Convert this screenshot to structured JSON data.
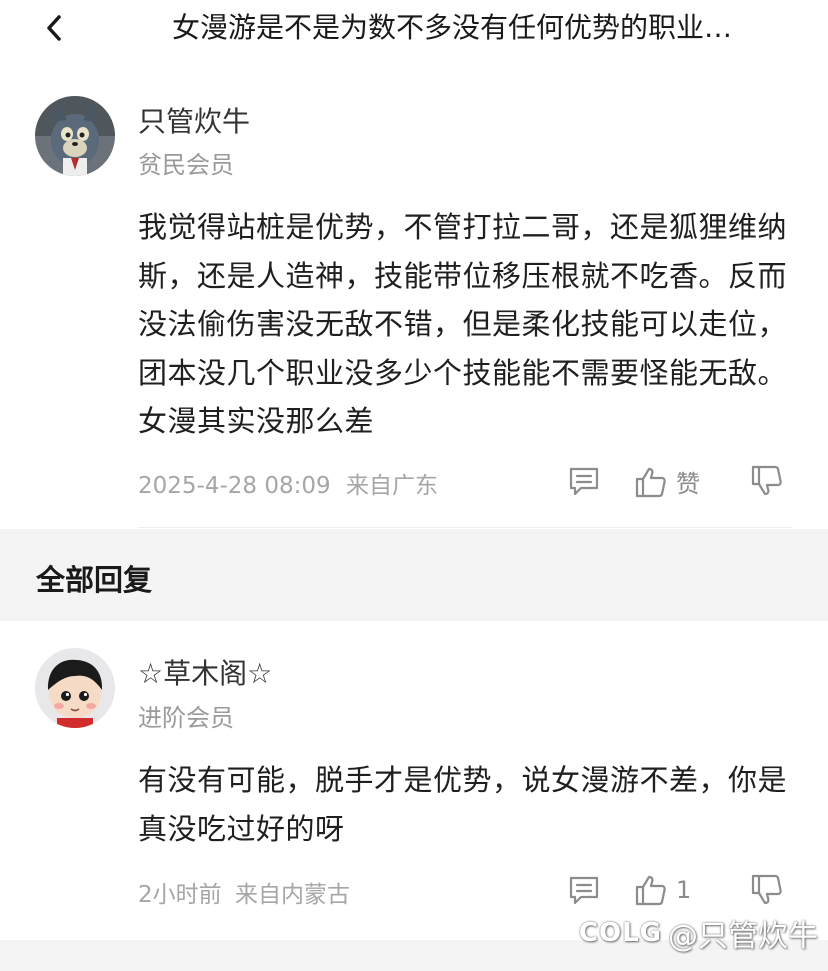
{
  "header": {
    "back_icon": "chevron-left-icon",
    "title": "女漫游是不是为数不多没有任何优势的职业…"
  },
  "post": {
    "username": "只管炊牛",
    "member_level": "贫民会员",
    "content": "我觉得站桩是优势，不管打拉二哥，还是狐狸维纳斯，还是人造神，技能带位移压根就不吃香。反而没法偷伤害没无敌不错，但是柔化技能可以走位，团本没几个职业没多少个技能能不需要怪能无敌。女漫其实没那么差",
    "timestamp": "2025-4-28 08:09",
    "location": "来自广东",
    "actions": {
      "comment_icon": "comment-icon",
      "like_icon": "thumbs-up-icon",
      "like_label": "赞",
      "dislike_icon": "thumbs-down-icon"
    }
  },
  "replies_section": {
    "title": "全部回复"
  },
  "replies": [
    {
      "username": "☆草木阁☆",
      "member_level": "进阶会员",
      "content": "有没有可能，脱手才是优势，说女漫游不差，你是真没吃过好的呀",
      "timestamp": "2小时前",
      "location": "来自内蒙古",
      "like_count": "1"
    }
  ],
  "watermark": {
    "logo": "COLG",
    "text": "@只管炊牛"
  },
  "colors": {
    "text_primary": "#1f1f1f",
    "text_secondary": "#9a9a9a",
    "section_bg": "#f4f4f4"
  }
}
